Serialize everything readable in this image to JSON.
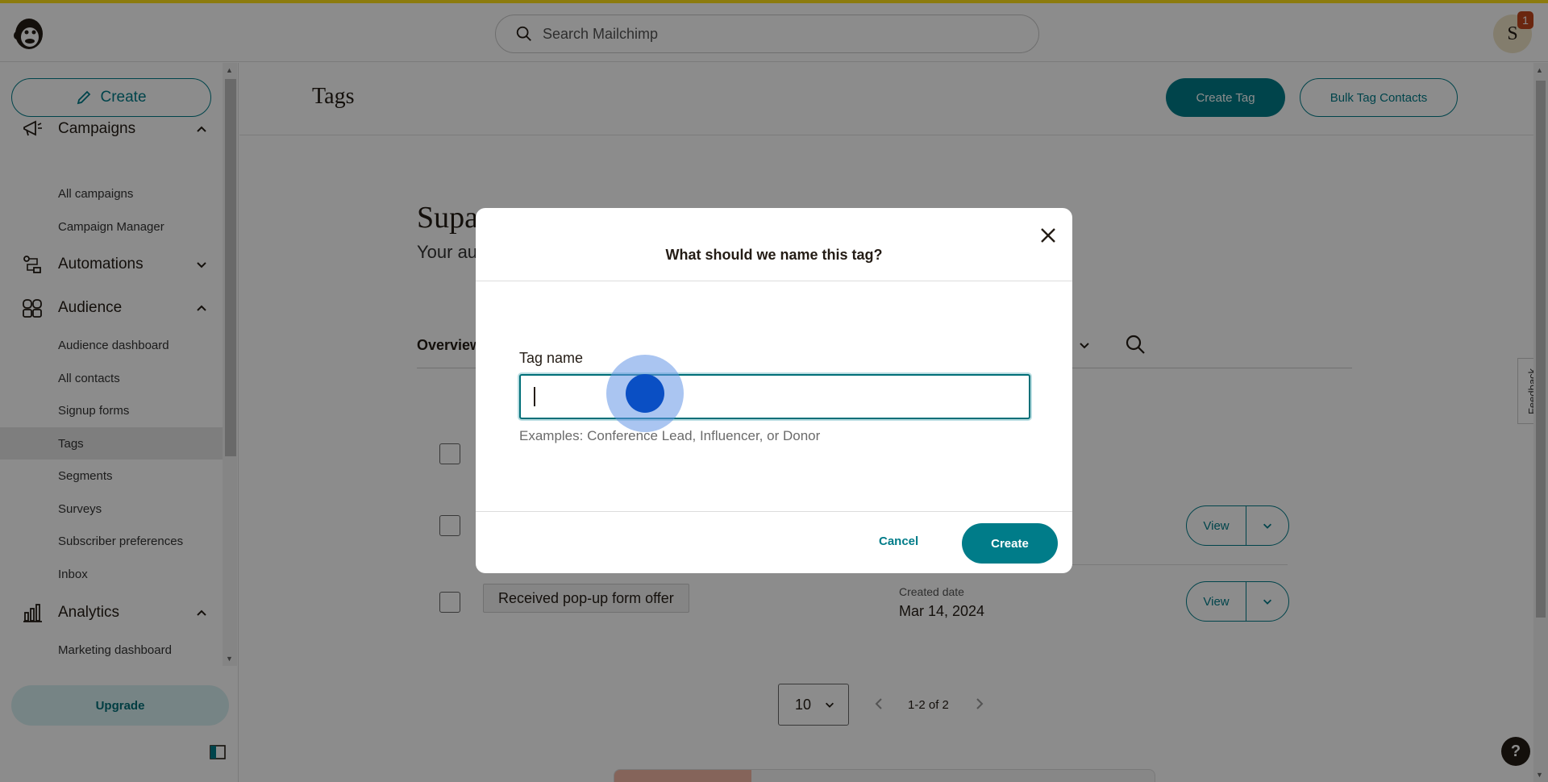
{
  "topbar": {
    "search_placeholder": "Search Mailchimp",
    "avatar_initial": "S",
    "notification_count": "1"
  },
  "sidebar": {
    "create_label": "Create",
    "sections": [
      {
        "label": "Campaigns",
        "expanded": true,
        "items": [
          "All campaigns",
          "Campaign Manager"
        ]
      },
      {
        "label": "Automations",
        "expanded": false,
        "items": []
      },
      {
        "label": "Audience",
        "expanded": true,
        "items": [
          "Audience dashboard",
          "All contacts",
          "Signup forms",
          "Tags",
          "Segments",
          "Surveys",
          "Subscriber preferences",
          "Inbox"
        ]
      },
      {
        "label": "Analytics",
        "expanded": true,
        "items": [
          "Marketing dashboard"
        ]
      }
    ],
    "active_item": "Tags",
    "upgrade_label": "Upgrade"
  },
  "page": {
    "title": "Tags",
    "create_tag_label": "Create Tag",
    "bulk_tag_label": "Bulk Tag Contacts",
    "bg_heading_partial": "Supa",
    "bg_sub_partial": "Your au",
    "bg_tab_partial": "Overview",
    "tag_row": {
      "name": "Received pop-up form offer",
      "meta_label": "Created date",
      "meta_value": "Mar 14, 2024"
    },
    "view_label": "View",
    "pager": {
      "page_size": "10",
      "range": "1-2 of 2"
    },
    "feedback_label": "Feedback",
    "help_label": "?"
  },
  "modal": {
    "title": "What should we name this tag?",
    "field_label": "Tag name",
    "field_value": "",
    "help_text": "Examples: Conference Lead, Influencer, or Donor",
    "cancel_label": "Cancel",
    "create_label": "Create"
  },
  "colors": {
    "brand_teal": "#007c89",
    "brand_yellow": "#ffe01b",
    "overlay": "rgba(0,0,0,0.45)"
  }
}
